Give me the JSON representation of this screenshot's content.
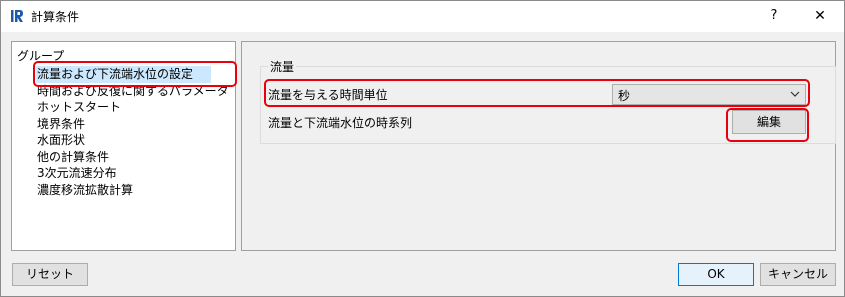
{
  "window": {
    "title": "計算条件",
    "help_label": "?",
    "close_label": "✕"
  },
  "group_panel": {
    "label": "グループ",
    "items": [
      "流量および下流端水位の設定",
      "時間および反復に関するパラメータ",
      "ホットスタート",
      "境界条件",
      "水面形状",
      "他の計算条件",
      "3次元流速分布",
      "濃度移流拡散計算"
    ],
    "selected_index": 0
  },
  "settings": {
    "group_title": "流量",
    "time_unit_label": "流量を与える時間単位",
    "time_unit_value": "秒",
    "series_label": "流量と下流端水位の時系列",
    "edit_label": "編集"
  },
  "footer": {
    "reset_label": "リセット",
    "ok_label": "OK",
    "cancel_label": "キャンセル"
  },
  "colors": {
    "highlight": "#e8000b",
    "selection": "#cce8ff",
    "ok_border": "#0078d7"
  }
}
